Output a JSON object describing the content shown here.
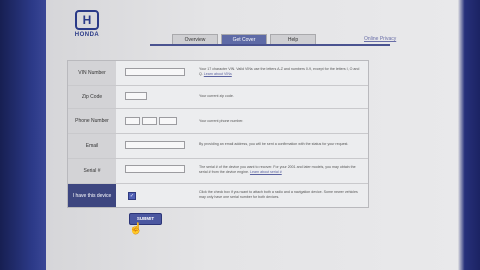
{
  "brand": {
    "wordmark": "HONDA",
    "colors": {
      "primary": "#2a3a88",
      "tab_active": "#5e6aa6",
      "dark_label": "#3d4680"
    }
  },
  "tabs": [
    {
      "label": "Overview",
      "active": false
    },
    {
      "label": "Get Cover",
      "active": true
    },
    {
      "label": "Help",
      "active": false
    }
  ],
  "privacy_link": "Online Privacy",
  "form": {
    "rows": [
      {
        "label": "VIN Number",
        "help": "Your 17 character VIN. Valid VINs use the letters A-Z and numbers 0-9, except for the letters I, O and Q.",
        "help_link": "Learn about VINs"
      },
      {
        "label": "Zip Code",
        "help": "Your current zip code."
      },
      {
        "label": "Phone Number",
        "help": "Your current phone number."
      },
      {
        "label": "Email",
        "help": "By providing an email address, you will be sent a confirmation with the status for your request."
      },
      {
        "label": "Serial #",
        "help": "The serial # of the device you want to recover. For your 2001 and later models, you may obtain the serial # from the device engine.",
        "help_link": "Learn about serial #"
      },
      {
        "label": "I have this device",
        "checked": true,
        "help": "Click the check box if you want to attach both a radio and a navigation device. Some newer vehicles may only have one serial number for both devices."
      }
    ],
    "submit_label": "SUBMIT"
  }
}
